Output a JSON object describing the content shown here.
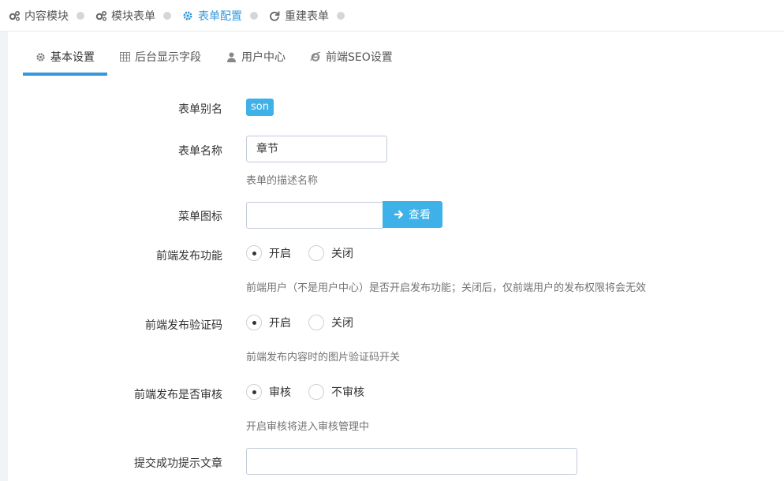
{
  "breadcrumb": {
    "items": [
      {
        "label": "内容模块",
        "icon": "cogs-icon",
        "active": false
      },
      {
        "label": "模块表单",
        "icon": "cogs-icon",
        "active": false
      },
      {
        "label": "表单配置",
        "icon": "gear-icon",
        "active": true
      },
      {
        "label": "重建表单",
        "icon": "refresh-icon",
        "active": false
      }
    ]
  },
  "tabs": [
    {
      "label": "基本设置",
      "icon": "gear-icon",
      "active": true
    },
    {
      "label": "后台显示字段",
      "icon": "table-icon",
      "active": false
    },
    {
      "label": "用户中心",
      "icon": "user-icon",
      "active": false
    },
    {
      "label": "前端SEO设置",
      "icon": "ie-icon",
      "active": false
    }
  ],
  "form": {
    "alias": {
      "label": "表单别名",
      "value": "son"
    },
    "name": {
      "label": "表单名称",
      "value": "章节",
      "help": "表单的描述名称"
    },
    "menu_icon": {
      "label": "菜单图标",
      "value": "",
      "button": "查看"
    },
    "publish": {
      "label": "前端发布功能",
      "options": [
        "开启",
        "关闭"
      ],
      "selected": "开启",
      "help": "前端用户（不是用户中心）是否开启发布功能；关闭后，仅前端用户的发布权限将会无效"
    },
    "captcha": {
      "label": "前端发布验证码",
      "options": [
        "开启",
        "关闭"
      ],
      "selected": "开启",
      "help": "前端发布内容时的图片验证码开关"
    },
    "review": {
      "label": "前端发布是否审核",
      "options": [
        "审核",
        "不审核"
      ],
      "selected": "审核",
      "help": "开启审核将进入审核管理中"
    },
    "success_msg": {
      "label": "提交成功提示文章",
      "value": ""
    }
  },
  "colors": {
    "accent": "#3598dc",
    "button": "#3eb2e8"
  }
}
